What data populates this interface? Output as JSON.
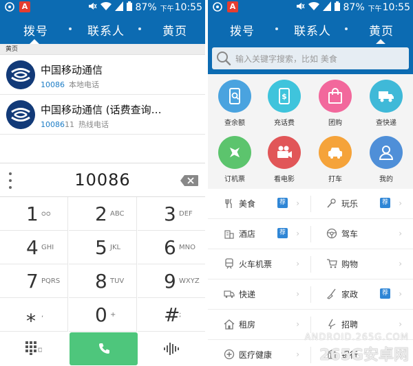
{
  "status_bar": {
    "battery": "87%",
    "ampm": "下午",
    "time": "10:55"
  },
  "tabs": [
    "拨号",
    "联系人",
    "黄页"
  ],
  "left": {
    "section_label": "黄页",
    "results": [
      {
        "name": "中国移动通信",
        "number": "10086",
        "type": "本地电话"
      },
      {
        "name": "中国移动通信 (话费查询…",
        "number_match": "10086",
        "number_rest": "11",
        "type": "热线电话"
      }
    ],
    "dialed_number": "10086",
    "keys": [
      {
        "digit": "1",
        "letters": "ᴑᴑ"
      },
      {
        "digit": "2",
        "letters": "ABC"
      },
      {
        "digit": "3",
        "letters": "DEF"
      },
      {
        "digit": "4",
        "letters": "GHI"
      },
      {
        "digit": "5",
        "letters": "JKL"
      },
      {
        "digit": "6",
        "letters": "MNO"
      },
      {
        "digit": "7",
        "letters": "PQRS"
      },
      {
        "digit": "8",
        "letters": "TUV"
      },
      {
        "digit": "9",
        "letters": "WXYZ"
      },
      {
        "digit": "⁎",
        "letters": ","
      },
      {
        "digit": "0",
        "letters": "+"
      },
      {
        "digit": "#",
        "letters": ";"
      }
    ]
  },
  "right": {
    "search_placeholder": "输入关键字搜索，比如 美食",
    "services": [
      {
        "label": "查余额",
        "color": "#4aa3df",
        "icon": "phone-search-icon"
      },
      {
        "label": "充话费",
        "color": "#3fc4dc",
        "icon": "phone-dollar-icon"
      },
      {
        "label": "团购",
        "color": "#f2689c",
        "icon": "shopping-bag-icon"
      },
      {
        "label": "查快递",
        "color": "#3fb9d8",
        "icon": "truck-icon"
      },
      {
        "label": "订机票",
        "color": "#5cc46d",
        "icon": "airplane-icon"
      },
      {
        "label": "看电影",
        "color": "#e15658",
        "icon": "movie-camera-icon"
      },
      {
        "label": "打车",
        "color": "#f5a33a",
        "icon": "car-icon"
      },
      {
        "label": "我的",
        "color": "#4f8fd8",
        "icon": "person-icon"
      }
    ],
    "categories": [
      {
        "label": "美食",
        "tag": "荐",
        "icon": "food-icon"
      },
      {
        "label": "玩乐",
        "tag": "荐",
        "icon": "play-icon"
      },
      {
        "label": "酒店",
        "tag": "荐",
        "icon": "hotel-icon"
      },
      {
        "label": "驾车",
        "tag": "",
        "icon": "steering-wheel-icon"
      },
      {
        "label": "火车机票",
        "tag": "",
        "icon": "train-icon"
      },
      {
        "label": "购物",
        "tag": "",
        "icon": "cart-icon"
      },
      {
        "label": "快递",
        "tag": "",
        "icon": "express-truck-icon"
      },
      {
        "label": "家政",
        "tag": "荐",
        "icon": "broom-icon"
      },
      {
        "label": "租房",
        "tag": "",
        "icon": "house-icon"
      },
      {
        "label": "招聘",
        "tag": "",
        "icon": "briefcase-icon"
      },
      {
        "label": "医疗健康",
        "tag": "",
        "icon": "medical-icon"
      },
      {
        "label": "银行",
        "tag": "",
        "icon": "bank-icon"
      }
    ],
    "watermark_line1": "ANDROID.265G.COM",
    "watermark_line2": "265G安卓网"
  },
  "colors": {
    "header_blue": "#0c6bb2",
    "call_green": "#4ec67c",
    "match_blue": "#1b7cc6"
  }
}
